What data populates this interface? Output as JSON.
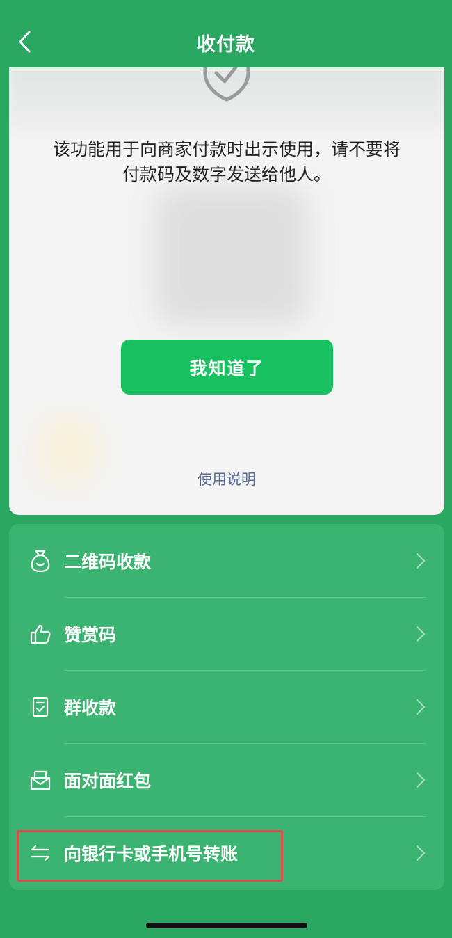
{
  "nav": {
    "title": "收付款",
    "back_icon": "chevron-left-icon"
  },
  "card": {
    "notice_line1": "该功能用于向商家付款时出示使用，请不要将",
    "notice_line2": "付款码及数字发送给他人。",
    "ok_button": "我知道了",
    "help_link": "使用说明",
    "shield_icon": "shield-check-icon"
  },
  "menu": {
    "items": [
      {
        "label": "二维码收款",
        "icon": "money-bag-icon"
      },
      {
        "label": "赞赏码",
        "icon": "thumbs-up-icon"
      },
      {
        "label": "群收款",
        "icon": "receipt-icon"
      },
      {
        "label": "面对面红包",
        "icon": "red-envelope-icon"
      },
      {
        "label": "向银行卡或手机号转账",
        "icon": "transfer-arrows-icon"
      }
    ]
  },
  "colors": {
    "background": "#2aa862",
    "menu_background": "#3cb471",
    "primary_button": "#19c05f",
    "link": "#576b95",
    "highlight": "#e04a4a"
  }
}
